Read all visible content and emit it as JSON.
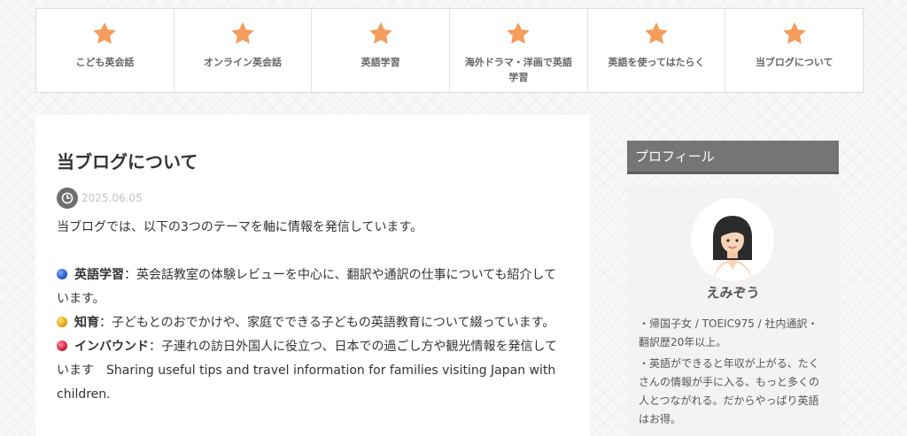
{
  "nav": {
    "items": [
      {
        "label": "こども英会話",
        "icon": "star-icon"
      },
      {
        "label": "オンライン英会話",
        "icon": "star-icon"
      },
      {
        "label": "英語学習",
        "icon": "star-icon"
      },
      {
        "label": "海外ドラマ・洋画で英語学習",
        "icon": "star-icon"
      },
      {
        "label": "英語を使ってはたらく",
        "icon": "star-icon"
      },
      {
        "label": "当ブログについて",
        "icon": "star-icon"
      }
    ],
    "accent_color": "#f39c5c"
  },
  "article": {
    "title": "当ブログについて",
    "date": "2025.06.05",
    "intro": "当ブログでは、以下の3つのテーマを軸に情報を発信しています。",
    "themes": [
      {
        "keyword": "英語学習",
        "text": "：英会話教室の体験レビューを中心に、翻訳や通訳の仕事についても紹介しています。",
        "dot_color": "blue"
      },
      {
        "keyword": "知育",
        "text": "：子どもとのおでかけや、家庭でできる子どもの英語教育について綴っています。",
        "dot_color": "yellow"
      },
      {
        "keyword": "インバウンド",
        "text": "：子連れの訪日外国人に役立つ、日本での過ごし方や観光情報を発信しています　Sharing useful tips and travel information for families visiting Japan with children.",
        "dot_color": "red"
      }
    ]
  },
  "sidebar": {
    "heading": "プロフィール",
    "name": "えみぞう",
    "bio": [
      "・帰国子女 / TOEIC975 / 社内通訳・翻訳歴20年以上。",
      "・英語ができると年収が上がる、たくさんの情報が手に入る、もっと多くの人とつながれる。だからやっぱり英語はお得。"
    ]
  }
}
